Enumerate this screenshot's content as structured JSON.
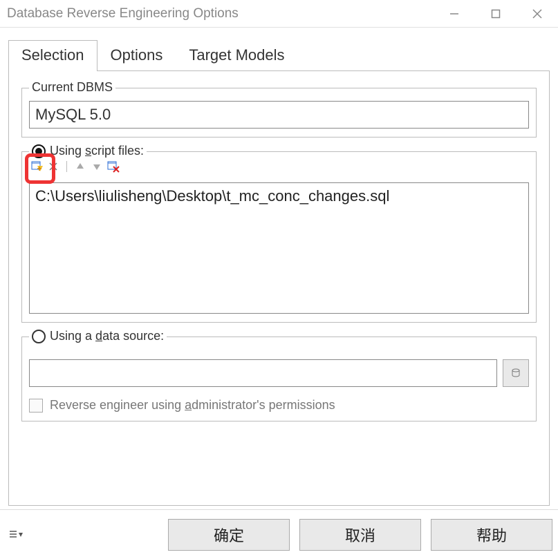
{
  "window": {
    "title": "Database Reverse Engineering Options"
  },
  "tabs": {
    "selection": "Selection",
    "options": "Options",
    "target_models": "Target Models",
    "active": "selection"
  },
  "current_dbms": {
    "label": "Current DBMS",
    "value": "MySQL 5.0"
  },
  "script": {
    "radio_label_pre": "Using ",
    "radio_label_u": "s",
    "radio_label_post": "cript files:",
    "selected": true,
    "files": [
      "C:\\Users\\liulisheng\\Desktop\\t_mc_conc_changes.sql"
    ],
    "icons": {
      "add": "add-file-icon",
      "delete": "delete-icon",
      "up": "move-up-icon",
      "down": "move-down-icon",
      "clear": "clear-list-icon"
    }
  },
  "datasource": {
    "radio_label_pre": "Using a ",
    "radio_label_u": "d",
    "radio_label_post": "ata source:",
    "selected": false,
    "value": "",
    "browse_icon": "database-browse-icon"
  },
  "admin_perm": {
    "label_pre": "Reverse engineer using ",
    "label_u": "a",
    "label_post": "dministrator's permissions",
    "checked": false
  },
  "buttons": {
    "ok": "确定",
    "cancel": "取消",
    "help": "帮助"
  }
}
